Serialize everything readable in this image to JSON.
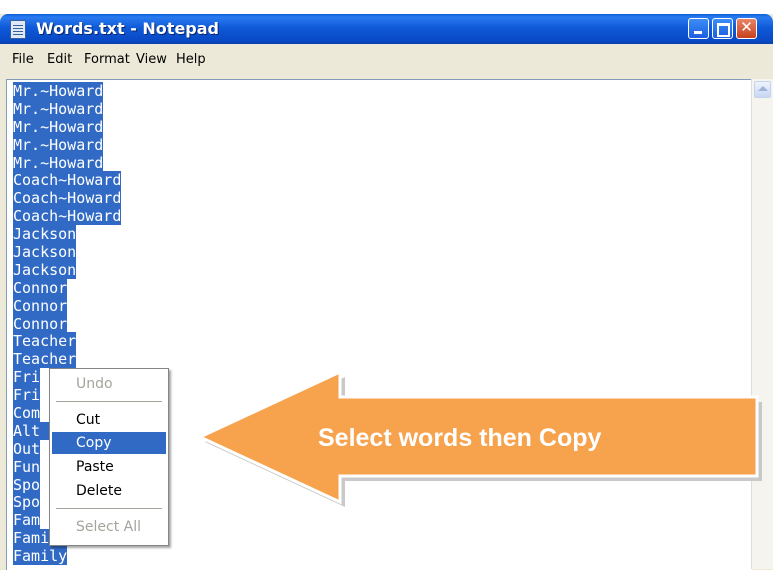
{
  "window": {
    "title": "Words.txt - Notepad",
    "minimize": "minimize",
    "maximize": "maximize",
    "close": "✕"
  },
  "menu": [
    "File",
    "Edit",
    "Format",
    "View",
    "Help"
  ],
  "editor": {
    "lines": [
      "Mr.~Howard",
      "Mr.~Howard",
      "Mr.~Howard",
      "Mr.~Howard",
      "Mr.~Howard",
      "Coach~Howard",
      "Coach~Howard",
      "Coach~Howard",
      "Jackson",
      "Jackson",
      "Jackson",
      "Connor",
      "Connor",
      "Connor",
      "Teacher",
      "Teacher",
      "Fri",
      "Fri",
      "Com",
      "Alt        ck",
      "Out",
      "Fun",
      "Spo",
      "Spo",
      "Fam",
      "Family",
      "Family"
    ]
  },
  "context_menu": {
    "undo": "Undo",
    "cut": "Cut",
    "copy": "Copy",
    "paste": "Paste",
    "delete": "Delete",
    "select_all": "Select All"
  },
  "annotation": {
    "text": "Select words then Copy",
    "color": "#f7a24c"
  },
  "colors": {
    "selection": "#316ac5",
    "titlebar": "#0a5fd8"
  }
}
